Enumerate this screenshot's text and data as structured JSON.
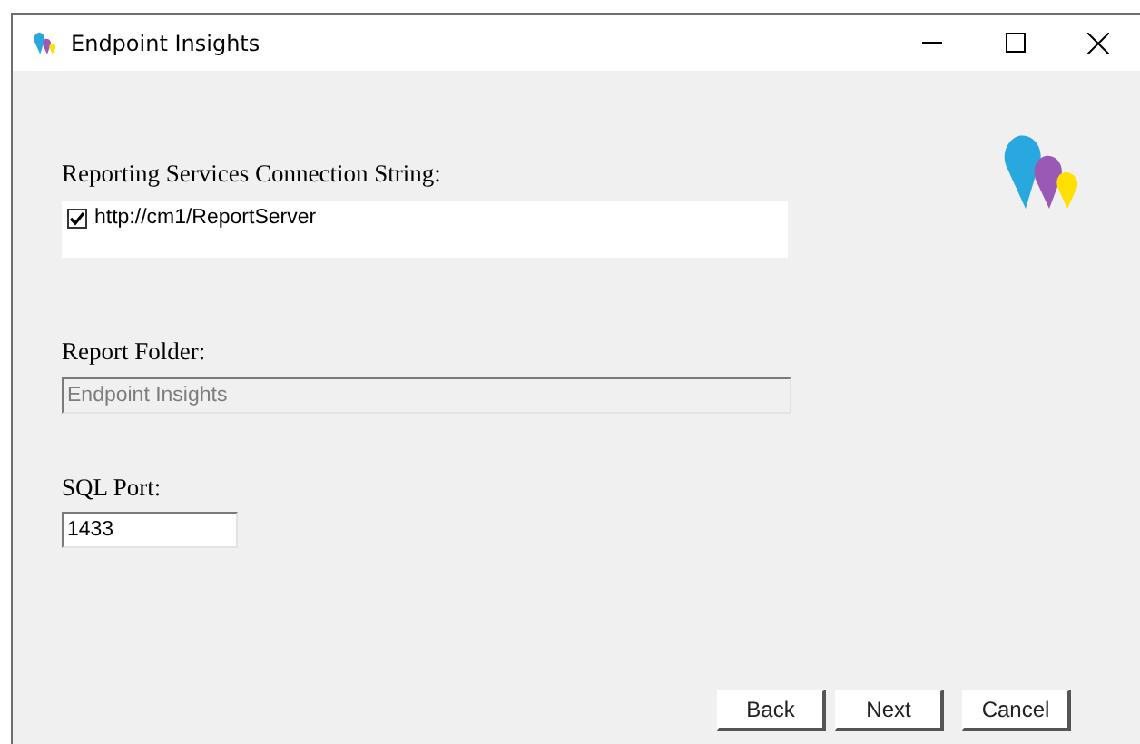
{
  "window": {
    "title": "Endpoint Insights"
  },
  "connection": {
    "label": "Reporting Services Connection String:",
    "items": [
      {
        "text": "http://cm1/ReportServer",
        "checked": true
      }
    ]
  },
  "report_folder": {
    "label": "Report Folder:",
    "value": "Endpoint Insights",
    "disabled": true
  },
  "sql_port": {
    "label": "SQL Port:",
    "value": "1433",
    "disabled": false
  },
  "buttons": [
    "Back",
    "Next",
    "Cancel"
  ]
}
